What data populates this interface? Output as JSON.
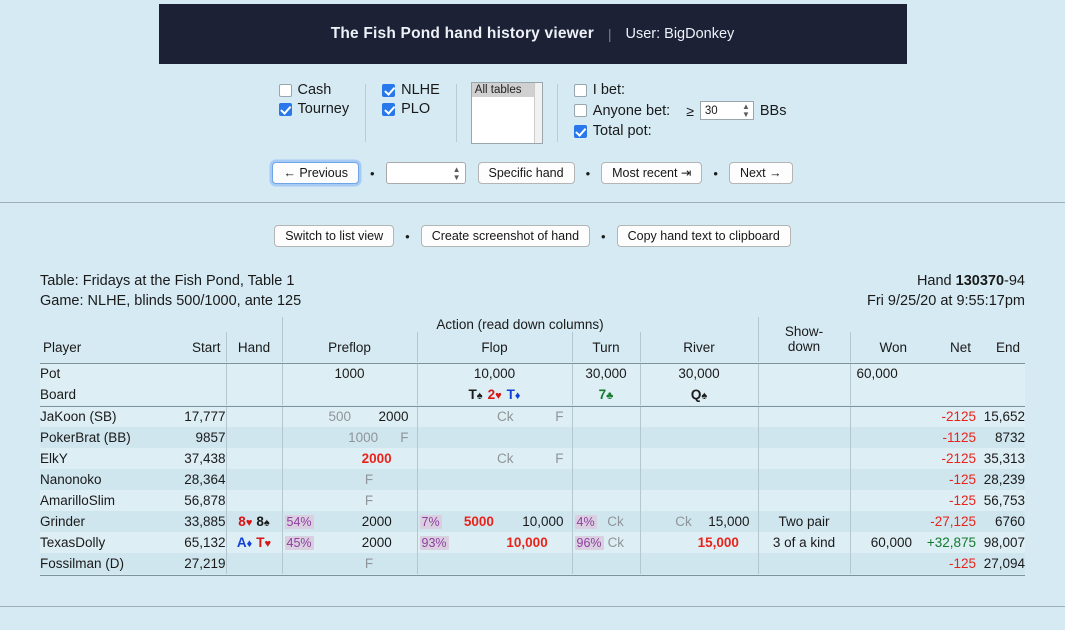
{
  "header": {
    "title": "The Fish Pond hand history viewer",
    "separator": "|",
    "user": "User: BigDonkey"
  },
  "filters": {
    "game_types": [
      {
        "label": "Cash",
        "checked": false
      },
      {
        "label": "Tourney",
        "checked": true
      }
    ],
    "variants": [
      {
        "label": "NLHE",
        "checked": true
      },
      {
        "label": "PLO",
        "checked": true
      }
    ],
    "tables_list": {
      "selected": "All tables"
    },
    "bet_filters": [
      {
        "label": "I bet:",
        "checked": false
      },
      {
        "label": "Anyone bet:",
        "checked": false
      },
      {
        "label": "Total pot:",
        "checked": true
      }
    ],
    "threshold": {
      "operator": "≥",
      "value": "30",
      "unit": "BBs"
    }
  },
  "nav": {
    "previous": "← Previous",
    "hand_number_input": "",
    "specific_hand": "Specific hand",
    "most_recent": "Most recent ⇥",
    "next": "Next →",
    "dot": "•"
  },
  "actions": {
    "switch_view": "Switch to list view",
    "screenshot": "Create screenshot of hand",
    "copy_text": "Copy hand text to clipboard",
    "dot": "•"
  },
  "hand_info": {
    "table": "Table: Fridays at the Fish Pond, Table 1",
    "game": "Game: NLHE, blinds 500/1000, ante 125",
    "hand_label": "Hand ",
    "hand_id": "130370",
    "hand_suffix": "-94",
    "datetime": "Fri 9/25/20 at 9:55:17pm"
  },
  "table": {
    "group_header": "Action (read down columns)",
    "columns": {
      "player": "Player",
      "start": "Start",
      "hand": "Hand",
      "preflop": "Preflop",
      "flop": "Flop",
      "turn": "Turn",
      "river": "River",
      "showdown_line1": "Show-",
      "showdown_line2": "down",
      "won": "Won",
      "net": "Net",
      "end": "End"
    },
    "pot_row": {
      "label": "Pot",
      "preflop": "1000",
      "flop": "10,000",
      "turn": "30,000",
      "river": "30,000",
      "won": "60,000"
    },
    "board_row": {
      "label": "Board",
      "flop": [
        {
          "rank": "T",
          "suit": "♠",
          "color": "spade"
        },
        {
          "rank": "2",
          "suit": "♥",
          "color": "heart"
        },
        {
          "rank": "T",
          "suit": "♦",
          "color": "diamond"
        }
      ],
      "turn": [
        {
          "rank": "7",
          "suit": "♣",
          "color": "club"
        }
      ],
      "river": [
        {
          "rank": "Q",
          "suit": "♠",
          "color": "spade"
        }
      ]
    },
    "players": [
      {
        "name": "JaKoon (SB)",
        "start": "17,777",
        "cards": [],
        "preflop": {
          "pct": "",
          "a": "500",
          "b": "2000",
          "a_style": "gray",
          "b_style": "plain"
        },
        "flop": {
          "pct": "",
          "a": "Ck",
          "b": "F",
          "a_style": "gray",
          "b_style": "gray"
        },
        "turn": {
          "pct": "",
          "a": "",
          "b": ""
        },
        "river": {
          "pct": "",
          "a": "",
          "b": ""
        },
        "showdown": "",
        "won": "",
        "net": "-2125",
        "net_style": "red",
        "end": "15,652"
      },
      {
        "name": "PokerBrat (BB)",
        "start": "9857",
        "cards": [],
        "preflop": {
          "pct": "",
          "a": "1000",
          "b": "F",
          "a_style": "gray",
          "b_style": "gray"
        },
        "flop": {
          "pct": "",
          "a": "",
          "b": ""
        },
        "turn": {
          "pct": "",
          "a": "",
          "b": ""
        },
        "river": {
          "pct": "",
          "a": "",
          "b": ""
        },
        "showdown": "",
        "won": "",
        "net": "-1125",
        "net_style": "red",
        "end": "8732"
      },
      {
        "name": "ElkY",
        "start": "37,438",
        "cards": [],
        "preflop": {
          "pct": "",
          "a": "2000",
          "b": "",
          "a_style": "red",
          "b_style": "plain"
        },
        "flop": {
          "pct": "",
          "a": "Ck",
          "b": "F",
          "a_style": "gray",
          "b_style": "gray"
        },
        "turn": {
          "pct": "",
          "a": "",
          "b": ""
        },
        "river": {
          "pct": "",
          "a": "",
          "b": ""
        },
        "showdown": "",
        "won": "",
        "net": "-2125",
        "net_style": "red",
        "end": "35,313"
      },
      {
        "name": "Nanonoko",
        "start": "28,364",
        "cards": [],
        "preflop": {
          "pct": "",
          "a": "F",
          "b": "",
          "a_style": "gray",
          "b_style": "plain"
        },
        "flop": {
          "pct": "",
          "a": "",
          "b": ""
        },
        "turn": {
          "pct": "",
          "a": "",
          "b": ""
        },
        "river": {
          "pct": "",
          "a": "",
          "b": ""
        },
        "showdown": "",
        "won": "",
        "net": "-125",
        "net_style": "red",
        "end": "28,239"
      },
      {
        "name": "AmarilloSlim",
        "start": "56,878",
        "cards": [],
        "preflop": {
          "pct": "",
          "a": "F",
          "b": "",
          "a_style": "gray",
          "b_style": "plain"
        },
        "flop": {
          "pct": "",
          "a": "",
          "b": ""
        },
        "turn": {
          "pct": "",
          "a": "",
          "b": ""
        },
        "river": {
          "pct": "",
          "a": "",
          "b": ""
        },
        "showdown": "",
        "won": "",
        "net": "-125",
        "net_style": "red",
        "end": "56,753"
      },
      {
        "name": "Grinder",
        "start": "33,885",
        "cards": [
          {
            "rank": "8",
            "suit": "♥",
            "color": "heart"
          },
          {
            "rank": "8",
            "suit": "♠",
            "color": "spade"
          }
        ],
        "preflop": {
          "pct": "54%",
          "a": "2000",
          "b": "",
          "a_style": "plain",
          "b_style": "plain"
        },
        "flop": {
          "pct": "7%",
          "a": "5000",
          "b": "10,000",
          "a_style": "red",
          "b_style": "plain"
        },
        "turn": {
          "pct": "4%",
          "a": "Ck",
          "b": "",
          "a_style": "gray",
          "b_style": "plain"
        },
        "river": {
          "pct": "",
          "a": "Ck",
          "b": "15,000",
          "a_style": "gray",
          "b_style": "plain"
        },
        "showdown": "Two pair",
        "showdown_bold": false,
        "won": "",
        "net": "-27,125",
        "net_style": "red",
        "end": "6760"
      },
      {
        "name": "TexasDolly",
        "start": "65,132",
        "cards": [
          {
            "rank": "A",
            "suit": "♦",
            "color": "diamond"
          },
          {
            "rank": "T",
            "suit": "♥",
            "color": "heart"
          }
        ],
        "preflop": {
          "pct": "45%",
          "a": "2000",
          "b": "",
          "a_style": "plain",
          "b_style": "plain"
        },
        "flop": {
          "pct": "93%",
          "a": "10,000",
          "b": "",
          "a_style": "red",
          "b_style": "plain"
        },
        "turn": {
          "pct": "96%",
          "a": "Ck",
          "b": "",
          "a_style": "gray",
          "b_style": "plain"
        },
        "river": {
          "pct": "",
          "a": "15,000",
          "b": "",
          "a_style": "red",
          "b_style": "plain"
        },
        "showdown": "3 of a kind",
        "showdown_bold": true,
        "won": "60,000",
        "net": "+32,875",
        "net_style": "green",
        "end": "98,007"
      },
      {
        "name": "Fossilman (D)",
        "start": "27,219",
        "cards": [],
        "preflop": {
          "pct": "",
          "a": "F",
          "b": "",
          "a_style": "gray",
          "b_style": "plain"
        },
        "flop": {
          "pct": "",
          "a": "",
          "b": ""
        },
        "turn": {
          "pct": "",
          "a": "",
          "b": ""
        },
        "river": {
          "pct": "",
          "a": "",
          "b": ""
        },
        "showdown": "",
        "won": "",
        "net": "-125",
        "net_style": "red",
        "end": "27,094"
      }
    ]
  }
}
